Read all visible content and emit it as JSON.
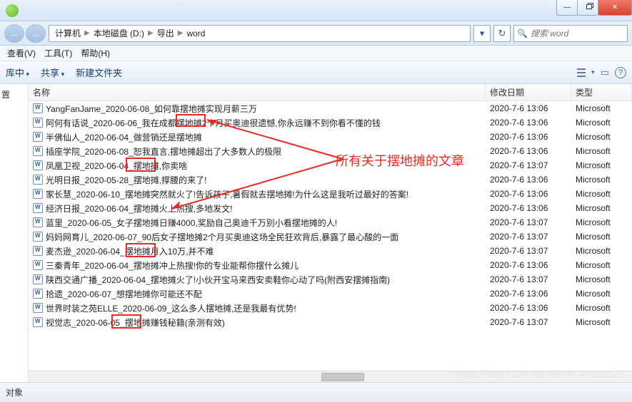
{
  "window": {
    "close": "✕",
    "min": "—"
  },
  "breadcrumb": {
    "b1": "计算机",
    "b2": "本地磁盘 (D:)",
    "b3": "导出",
    "b4": "word"
  },
  "search": {
    "placeholder": "搜索 word"
  },
  "menu": {
    "view": "查看(V)",
    "tools": "工具(T)",
    "help": "帮助(H)"
  },
  "toolbar": {
    "lib": "库中",
    "share": "共享",
    "newf": "新建文件夹"
  },
  "columns": {
    "name": "名称",
    "date": "修改日期",
    "type": "类型"
  },
  "sidebar": {
    "i1": "置"
  },
  "annotation": {
    "text": "所有关于摆地摊的文章"
  },
  "files": [
    {
      "name": "YangFanJame_2020-06-08_如何靠摆地摊实现月薪三万",
      "date": "2020-7-6 13:06",
      "type": "Microsoft"
    },
    {
      "name": "阿何有话说_2020-06-06_我在成都摆地摊2个月买奥迪很遗憾,你永远赚不到你看不懂的钱",
      "date": "2020-7-6 13:06",
      "type": "Microsoft"
    },
    {
      "name": "半佛仙人_2020-06-04_做营销还是摆地摊",
      "date": "2020-7-6 13:06",
      "type": "Microsoft"
    },
    {
      "name": "插座学院_2020-06-08_恕我直言,摆地摊超出了大多数人的极限",
      "date": "2020-7-6 13:06",
      "type": "Microsoft"
    },
    {
      "name": "凤凰卫视_2020-06-04_摆地摊,你卖啥",
      "date": "2020-7-6 13:07",
      "type": "Microsoft"
    },
    {
      "name": "光明日报_2020-05-28_摆地摊,撑腰的来了!",
      "date": "2020-7-6 13:06",
      "type": "Microsoft"
    },
    {
      "name": "家长慧_2020-06-10_摆地摊突然就火了!告诉孩子,暑假就去摆地摊!为什么这是我听过最好的答案!",
      "date": "2020-7-6 13:06",
      "type": "Microsoft"
    },
    {
      "name": "经济日报_2020-06-04_摆地摊火上热搜,多地发文!",
      "date": "2020-7-6 13:06",
      "type": "Microsoft"
    },
    {
      "name": "蓝里_2020-06-05_女子摆地摊日赚4000,奖励自己奥迪千万别小看摆地摊的人!",
      "date": "2020-7-6 13:07",
      "type": "Microsoft"
    },
    {
      "name": "妈妈网育儿_2020-06-07_90后女子摆地摊2个月买奥迪这场全民狂欢背后,暴露了最心酸的一面",
      "date": "2020-7-6 13:07",
      "type": "Microsoft"
    },
    {
      "name": "麦杰逊_2020-06-04_摆地摊月入10万,并不难",
      "date": "2020-7-6 13:07",
      "type": "Microsoft"
    },
    {
      "name": "三秦青年_2020-06-04_摆地摊冲上热搜!你的专业能帮你摆什么摊儿",
      "date": "2020-7-6 13:06",
      "type": "Microsoft"
    },
    {
      "name": "陕西交通广播_2020-06-04_摆地摊火了!小伙开宝马来西安卖鞋你心动了吗(附西安摆摊指南)",
      "date": "2020-7-6 13:07",
      "type": "Microsoft"
    },
    {
      "name": "拾遗_2020-06-07_想摆地摊你可能还不配",
      "date": "2020-7-6 13:06",
      "type": "Microsoft"
    },
    {
      "name": "世界时装之苑ELLE_2020-06-09_这么多人摆地摊,还是我最有优势!",
      "date": "2020-7-6 13:06",
      "type": "Microsoft"
    },
    {
      "name": "视觉志_2020-06-05_摆地摊赚钱秘籍(亲测有效)",
      "date": "2020-7-6 13:07",
      "type": "Microsoft"
    }
  ],
  "status": {
    "label": "对象"
  },
  "watermark": {
    "text": "https://blog.csdn.net/weixin_46181627"
  }
}
